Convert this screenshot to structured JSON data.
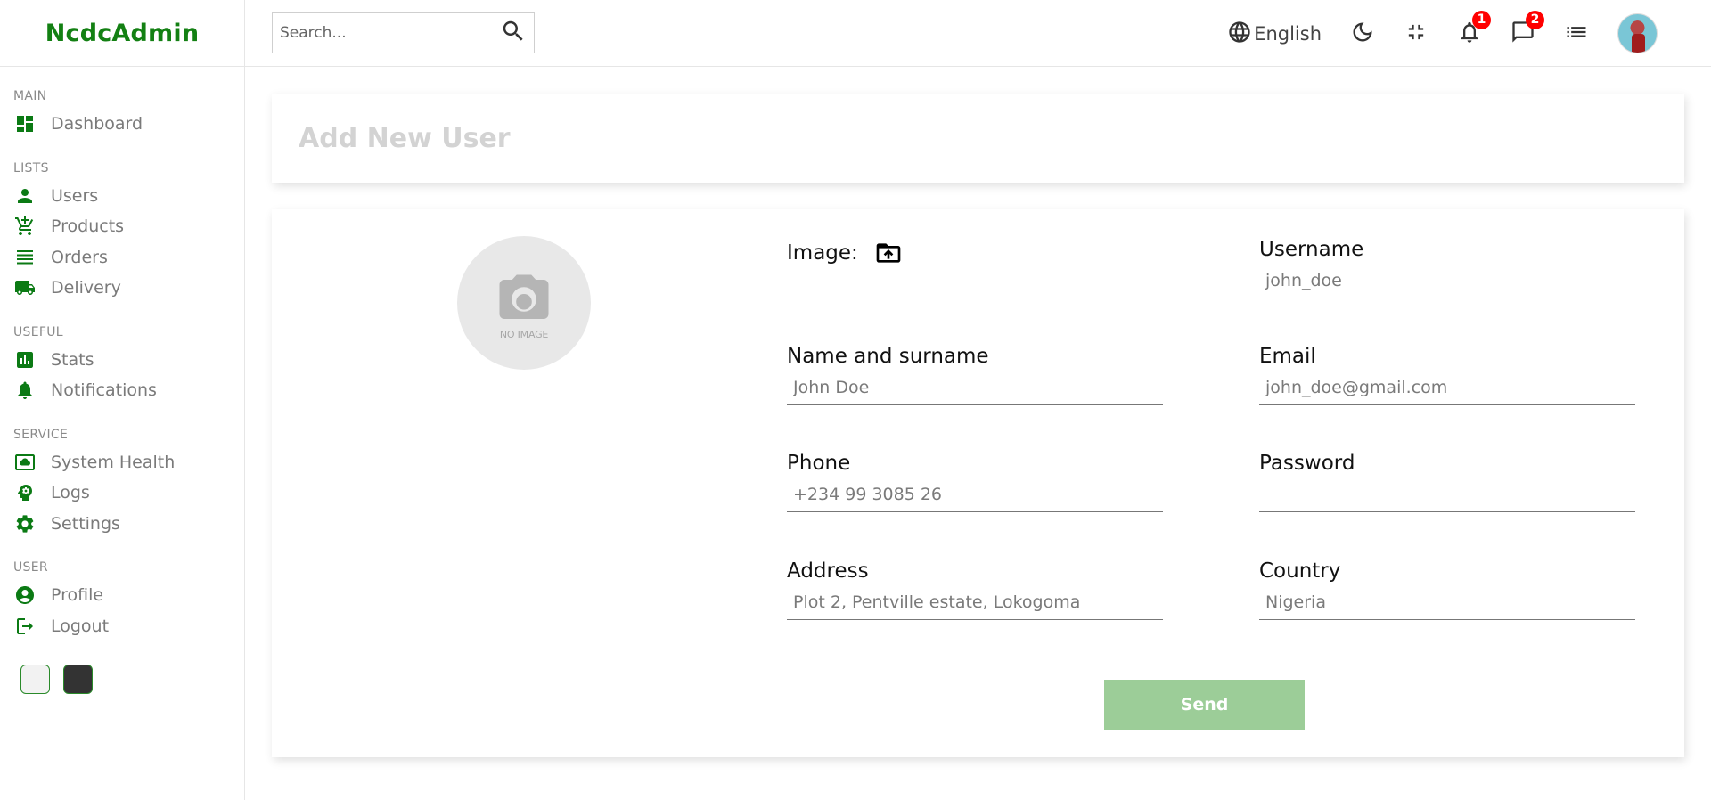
{
  "app": {
    "logo": "NcdcAdmin"
  },
  "sidebar": {
    "sections": [
      {
        "title": "MAIN",
        "items": [
          {
            "label": "Dashboard",
            "icon": "dashboard-icon"
          }
        ]
      },
      {
        "title": "LISTS",
        "items": [
          {
            "label": "Users",
            "icon": "person-icon"
          },
          {
            "label": "Products",
            "icon": "cart-icon"
          },
          {
            "label": "Orders",
            "icon": "list-icon"
          },
          {
            "label": "Delivery",
            "icon": "truck-icon"
          }
        ]
      },
      {
        "title": "USEFUL",
        "items": [
          {
            "label": "Stats",
            "icon": "bar-chart-icon"
          },
          {
            "label": "Notifications",
            "icon": "bell-icon"
          }
        ]
      },
      {
        "title": "SERVICE",
        "items": [
          {
            "label": "System Health",
            "icon": "cloud-monitor-icon"
          },
          {
            "label": "Logs",
            "icon": "brain-icon"
          },
          {
            "label": "Settings",
            "icon": "gear-icon"
          }
        ]
      },
      {
        "title": "USER",
        "items": [
          {
            "label": "Profile",
            "icon": "account-circle-icon"
          },
          {
            "label": "Logout",
            "icon": "logout-icon"
          }
        ]
      }
    ],
    "theme_colors": {
      "light": "#f2f2f2",
      "dark": "#333333"
    }
  },
  "topbar": {
    "search_placeholder": "Search...",
    "language": "English",
    "notifications_count": "1",
    "messages_count": "2"
  },
  "page": {
    "title": "Add New User",
    "no_image_text": "NO IMAGE",
    "image_label": "Image:",
    "fields": {
      "name": {
        "label": "Name and surname",
        "placeholder": "John Doe"
      },
      "phone": {
        "label": "Phone",
        "placeholder": "+234 99 3085 26"
      },
      "address": {
        "label": "Address",
        "placeholder": "Plot 2, Pentville estate, Lokogoma"
      },
      "username": {
        "label": "Username",
        "placeholder": "john_doe"
      },
      "email": {
        "label": "Email",
        "placeholder": "john_doe@gmail.com"
      },
      "password": {
        "label": "Password",
        "placeholder": ""
      },
      "country": {
        "label": "Country",
        "placeholder": "Nigeria"
      }
    },
    "send_label": "Send"
  },
  "colors": {
    "brand": "#138013",
    "icon": "#0b7a14",
    "send_button": "#9ccd98",
    "badge": "#ff0000"
  }
}
